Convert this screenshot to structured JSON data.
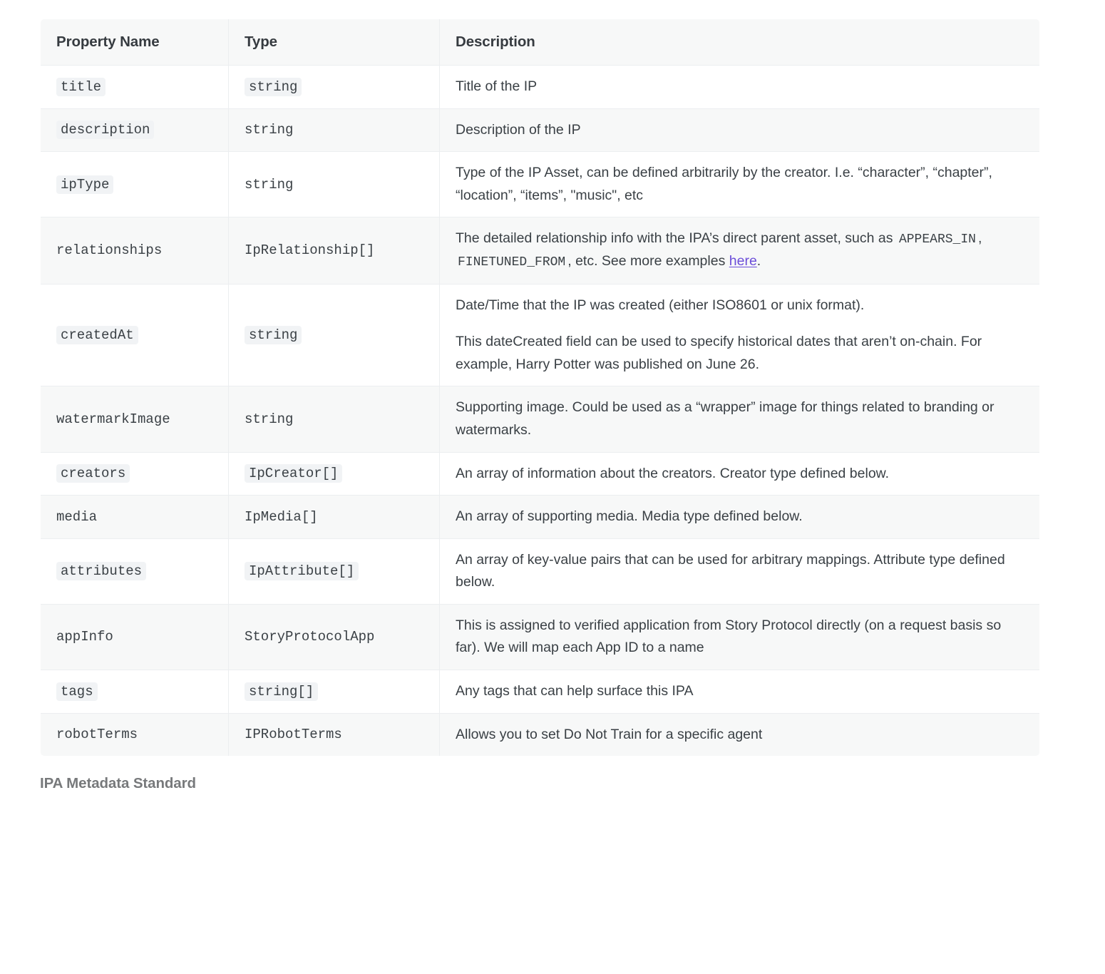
{
  "table": {
    "headers": [
      "Property Name",
      "Type",
      "Description"
    ],
    "rows": [
      {
        "property": "title",
        "property_code": true,
        "type": "string",
        "type_code": true,
        "stripe": "white",
        "description_parts": [
          [
            {
              "t": "text",
              "v": "Title of the IP"
            }
          ]
        ]
      },
      {
        "property": "description",
        "property_code": true,
        "type": "string",
        "type_code": false,
        "stripe": "grey",
        "description_parts": [
          [
            {
              "t": "text",
              "v": "Description of the IP"
            }
          ]
        ]
      },
      {
        "property": "ipType",
        "property_code": true,
        "type": "string",
        "type_code": false,
        "stripe": "white",
        "description_parts": [
          [
            {
              "t": "text",
              "v": "Type of the IP Asset, can be defined arbitrarily by the creator. I.e. “character”, “chapter”, “location”, “items”, \"music\", etc"
            }
          ]
        ]
      },
      {
        "property": "relationships",
        "property_code": false,
        "type": "IpRelationship[]",
        "type_code": false,
        "stripe": "grey",
        "description_parts": [
          [
            {
              "t": "text",
              "v": "The detailed relationship info with the IPA’s direct parent asset, such as "
            },
            {
              "t": "code",
              "v": "APPEARS_IN"
            },
            {
              "t": "text",
              "v": ", "
            },
            {
              "t": "code",
              "v": "FINETUNED_FROM"
            },
            {
              "t": "text",
              "v": ", etc. See more examples "
            },
            {
              "t": "link",
              "v": "here"
            },
            {
              "t": "text",
              "v": "."
            }
          ]
        ]
      },
      {
        "property": "createdAt",
        "property_code": true,
        "type": "string",
        "type_code": true,
        "stripe": "white",
        "description_parts": [
          [
            {
              "t": "text",
              "v": "Date/Time that the IP was created (either ISO8601 or unix format)."
            }
          ],
          [
            {
              "t": "text",
              "v": "This dateCreated field can be used to specify historical dates that aren’t on-chain. For example, Harry Potter was published on June 26."
            }
          ]
        ]
      },
      {
        "property": "watermarkImage",
        "property_code": false,
        "type": "string",
        "type_code": false,
        "stripe": "grey",
        "description_parts": [
          [
            {
              "t": "text",
              "v": "Supporting image. Could be used as a “wrapper” image for things related to branding or watermarks."
            }
          ]
        ]
      },
      {
        "property": "creators",
        "property_code": true,
        "type": "IpCreator[]",
        "type_code": true,
        "stripe": "white",
        "description_parts": [
          [
            {
              "t": "text",
              "v": "An array of information about the creators. Creator type defined below."
            }
          ]
        ]
      },
      {
        "property": "media",
        "property_code": false,
        "type": "IpMedia[]",
        "type_code": false,
        "stripe": "grey",
        "description_parts": [
          [
            {
              "t": "text",
              "v": "An array of supporting media. Media type defined below."
            }
          ]
        ]
      },
      {
        "property": "attributes",
        "property_code": true,
        "type": "IpAttribute[]",
        "type_code": true,
        "stripe": "white",
        "description_parts": [
          [
            {
              "t": "text",
              "v": "An array of key-value pairs that can be used for arbitrary mappings. Attribute type defined below."
            }
          ]
        ]
      },
      {
        "property": "appInfo",
        "property_code": false,
        "type": "StoryProtocolApp",
        "type_code": false,
        "stripe": "grey",
        "description_parts": [
          [
            {
              "t": "text",
              "v": "This is assigned to verified application from Story Protocol directly (on a request basis so far). We will map each App ID to a name"
            }
          ]
        ]
      },
      {
        "property": "tags",
        "property_code": true,
        "type": "string[]",
        "type_code": true,
        "stripe": "white",
        "description_parts": [
          [
            {
              "t": "text",
              "v": "Any tags that can help surface this IPA"
            }
          ]
        ]
      },
      {
        "property": "robotTerms",
        "property_code": false,
        "type": "IPRobotTerms",
        "type_code": false,
        "stripe": "grey",
        "description_parts": [
          [
            {
              "t": "text",
              "v": "Allows you to set Do Not Train for a specific agent"
            }
          ]
        ]
      }
    ]
  },
  "caption": "IPA Metadata Standard"
}
